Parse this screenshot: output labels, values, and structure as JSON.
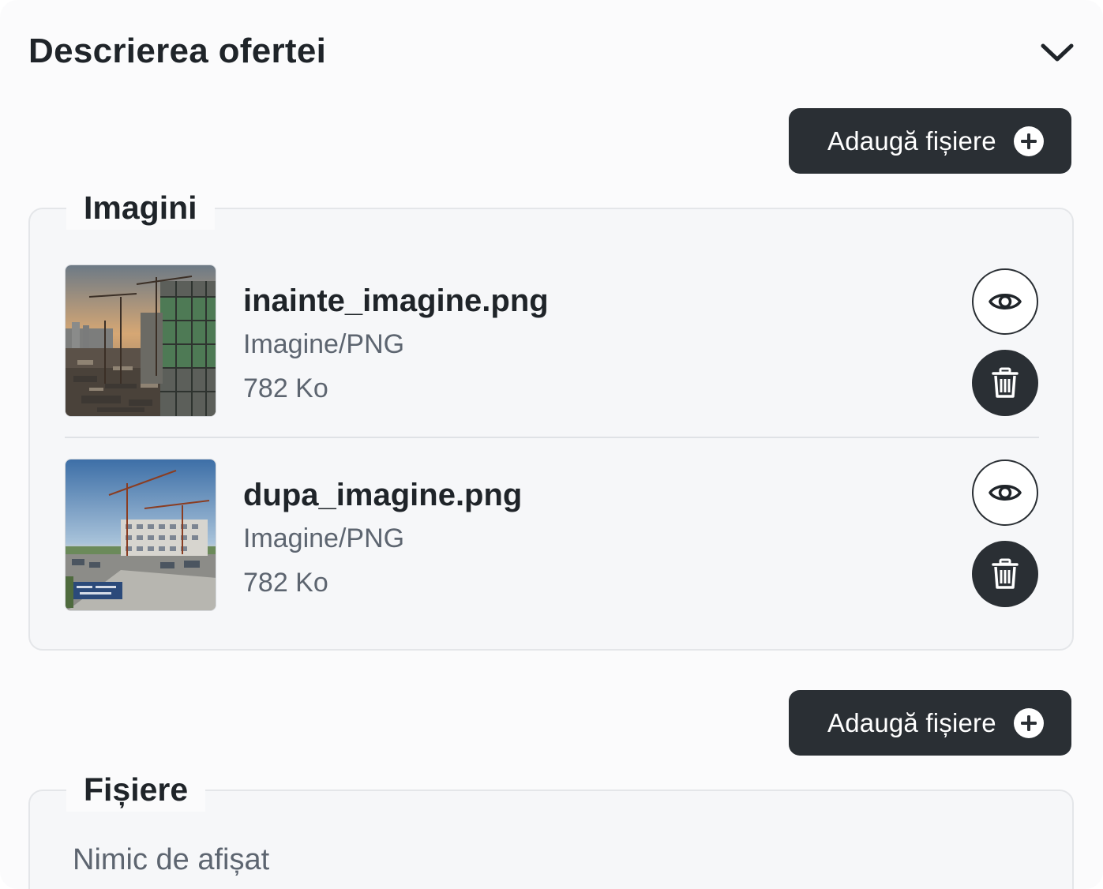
{
  "section": {
    "title": "Descrierea ofertei",
    "collapse_icon": "chevron-down-icon"
  },
  "add_files_label": "Adaugă fișiere",
  "images": {
    "legend": "Imagini",
    "items": [
      {
        "name": "inainte_imagine.png",
        "type": "Imagine/PNG",
        "size": "782 Ko",
        "thumbnail": "construction-site-before"
      },
      {
        "name": "dupa_imagine.png",
        "type": "Imagine/PNG",
        "size": "782 Ko",
        "thumbnail": "construction-site-after"
      }
    ]
  },
  "files": {
    "legend": "Fișiere",
    "empty_text": "Nimic de afișat"
  },
  "colors": {
    "button_dark": "#2a2f34",
    "background": "#fbfbfc",
    "muted_text": "#5d6570"
  }
}
